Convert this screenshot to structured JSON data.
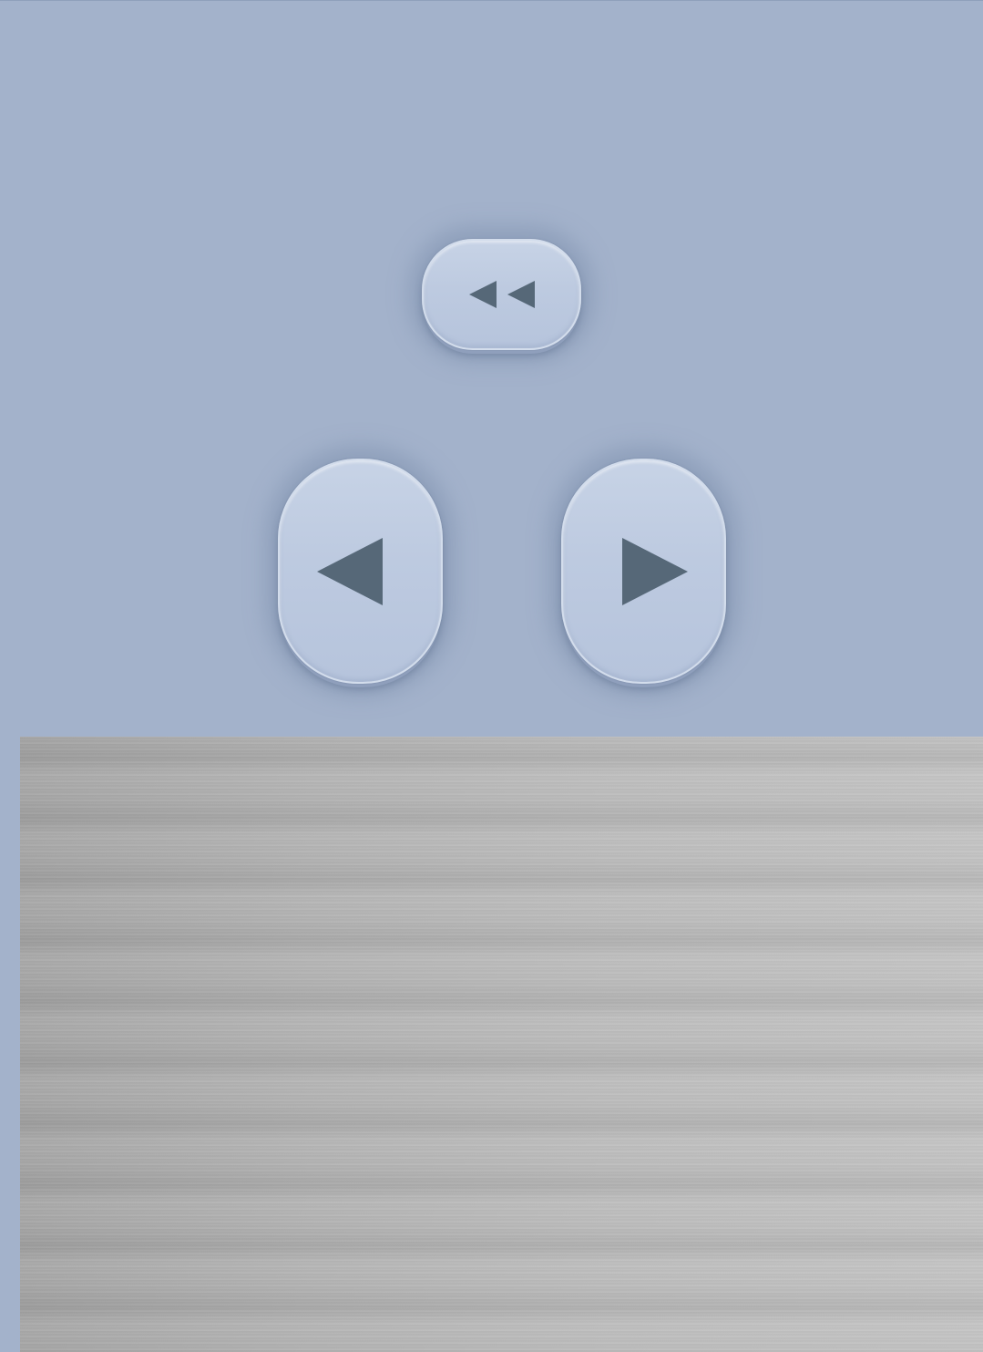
{
  "screen": {
    "background_color": "#a3b2cb",
    "panel_color": "#b4b4b4",
    "glyph_color": "#566878"
  },
  "controls": {
    "rewind": {
      "icon": "rewind-icon"
    },
    "previous": {
      "icon": "triangle-left-icon"
    },
    "next": {
      "icon": "triangle-right-icon"
    }
  },
  "panel": {
    "style": "brushed-metal"
  }
}
